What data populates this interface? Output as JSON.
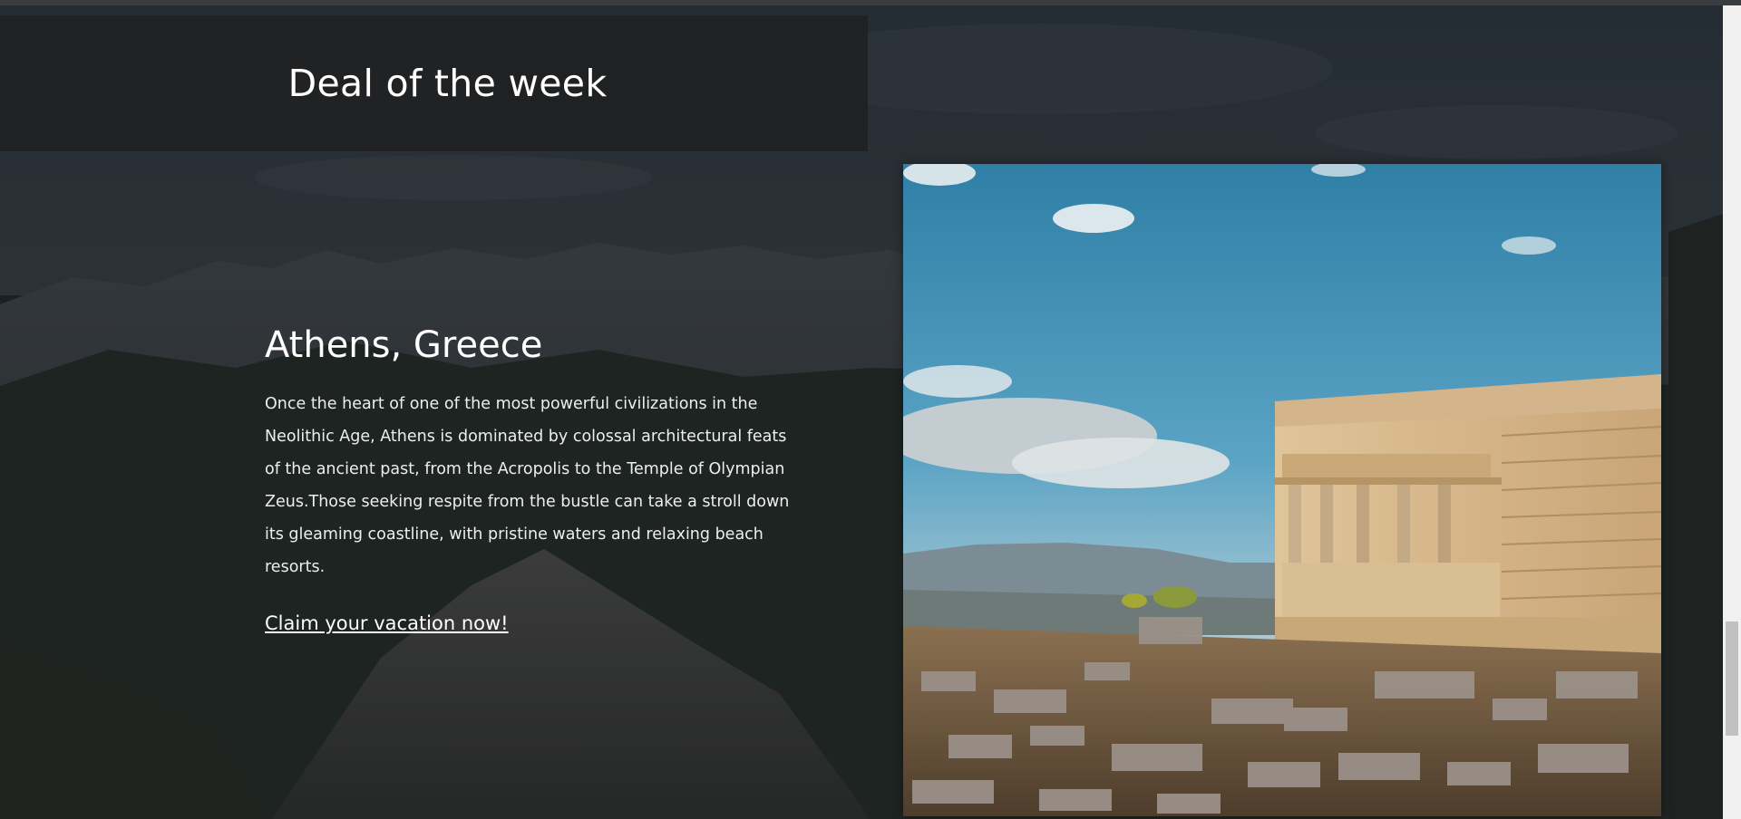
{
  "header": {
    "title": "Deal of the week"
  },
  "deal": {
    "destination": "Athens, Greece",
    "description": "Once the heart of one of the most powerful civilizations in the Neolithic Age, Athens is dominated by colossal architectural feats of the ancient past, from the Acropolis to the Temple of Olympian Zeus.Those seeking respite from the bustle can take a stroll down its gleaming coastline, with pristine waters and relaxing beach resorts.",
    "cta_label": "Claim your vacation now!"
  },
  "colors": {
    "header_bg": "#1e1e1e",
    "text": "#ffffff",
    "sky": "#3b8fb5"
  },
  "icons": {
    "scrollbar": "vertical-scrollbar"
  }
}
